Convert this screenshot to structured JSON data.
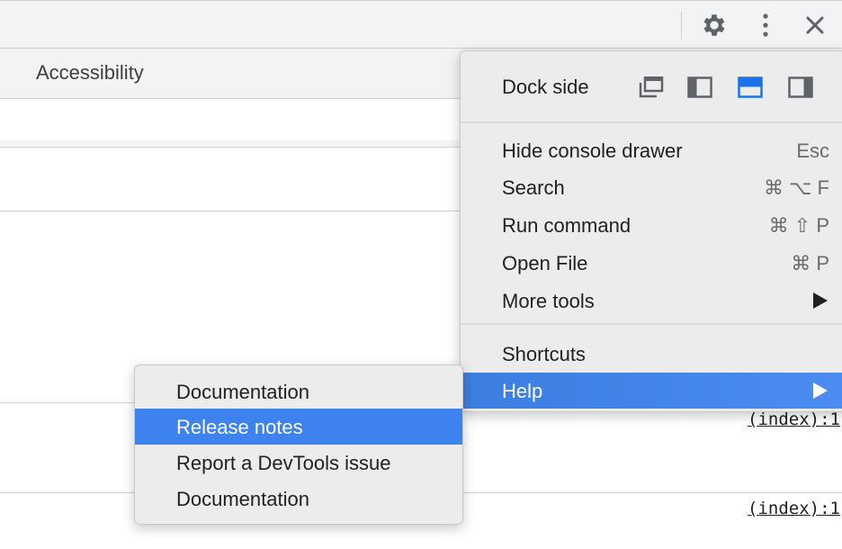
{
  "toolbar": {
    "icons": [
      "gear-icon",
      "kebab-menu-icon",
      "close-icon"
    ]
  },
  "tabs": {
    "visible_tab": "Accessibility"
  },
  "console": {
    "source_links": [
      "(index):1",
      "(index):1"
    ]
  },
  "menu": {
    "dock_side_label": "Dock side",
    "dock_options": [
      "undock-icon",
      "dock-left-icon",
      "dock-bottom-icon",
      "dock-right-icon"
    ],
    "dock_selected": "dock-bottom-icon",
    "items": [
      {
        "label": "Hide console drawer",
        "shortcut": "Esc"
      },
      {
        "label": "Search",
        "shortcut": "⌘ ⌥ F"
      },
      {
        "label": "Run command",
        "shortcut": "⌘ ⇧ P"
      },
      {
        "label": "Open File",
        "shortcut": "⌘ P"
      },
      {
        "label": "More tools",
        "shortcut": ""
      }
    ],
    "shortcuts_label": "Shortcuts",
    "help_label": "Help"
  },
  "submenu": {
    "items": [
      "Documentation",
      "Release notes",
      "Report a DevTools issue",
      "Documentation"
    ],
    "highlighted": "Release notes"
  },
  "colors": {
    "highlight": "#3d82ee",
    "menu_bg": "#ececec",
    "toolbar_bg": "#f1f3f4"
  }
}
